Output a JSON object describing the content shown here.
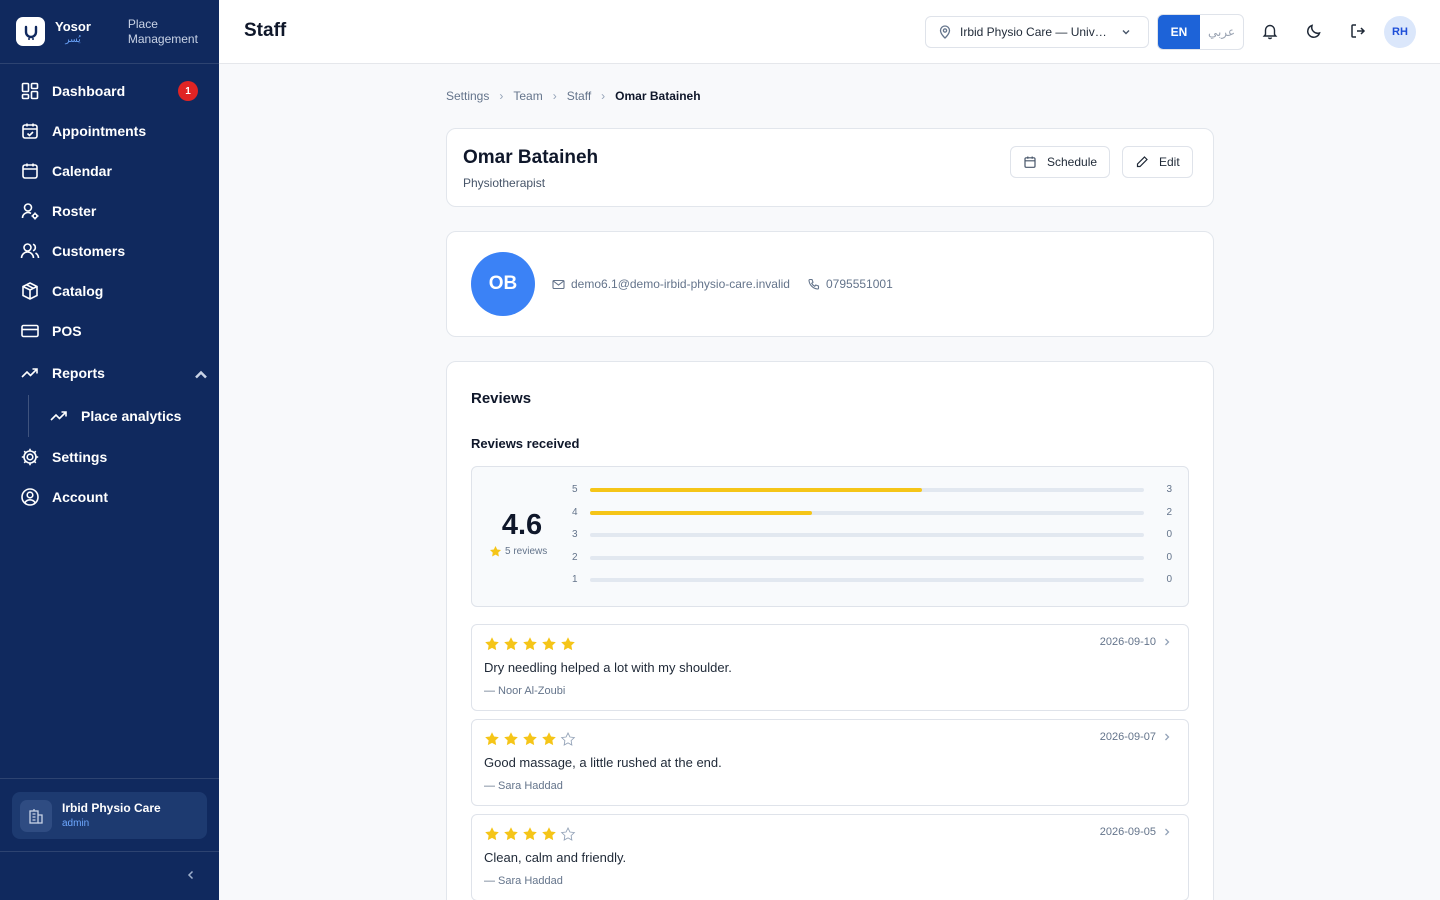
{
  "brand": {
    "name": "Yosor",
    "name_ar": "يُسر",
    "subtitle_line1": "Place",
    "subtitle_line2": "Management"
  },
  "nav": {
    "items": [
      {
        "label": "Dashboard",
        "icon": "dashboard-icon",
        "badge": "1"
      },
      {
        "label": "Appointments",
        "icon": "calendar-check-icon"
      },
      {
        "label": "Calendar",
        "icon": "calendar-icon"
      },
      {
        "label": "Roster",
        "icon": "user-cog-icon"
      },
      {
        "label": "Customers",
        "icon": "users-icon"
      },
      {
        "label": "Catalog",
        "icon": "package-icon"
      },
      {
        "label": "POS",
        "icon": "credit-card-icon"
      },
      {
        "label": "Reports",
        "icon": "trending-up-icon",
        "expanded": true
      },
      {
        "label": "Place analytics",
        "icon": "trending-up-icon"
      },
      {
        "label": "Settings",
        "icon": "gear-icon"
      },
      {
        "label": "Account",
        "icon": "user-circle-icon"
      }
    ]
  },
  "sidebar_footer": {
    "place_name": "Irbid Physio Care",
    "role": "admin"
  },
  "header": {
    "title": "Staff",
    "place_select": "Irbid Physio Care — University Street",
    "lang_en": "EN",
    "lang_ar": "عربي",
    "user_initials": "RH"
  },
  "breadcrumb": [
    "Settings",
    "Team",
    "Staff",
    "Omar Bataineh"
  ],
  "staff": {
    "name": "Omar Bataineh",
    "role": "Physiotherapist",
    "initials": "OB",
    "email": "demo6.1@demo-irbid-physio-care.invalid",
    "phone": "0795551001",
    "schedule_label": "Schedule",
    "edit_label": "Edit"
  },
  "reviews": {
    "title": "Reviews",
    "subtitle": "Reviews received",
    "average": "4.6",
    "count_text": "5 reviews",
    "distribution": [
      {
        "stars": "5",
        "count": "3",
        "fraction": 0.6
      },
      {
        "stars": "4",
        "count": "2",
        "fraction": 0.4
      },
      {
        "stars": "3",
        "count": "0",
        "fraction": 0
      },
      {
        "stars": "2",
        "count": "0",
        "fraction": 0
      },
      {
        "stars": "1",
        "count": "0",
        "fraction": 0
      }
    ],
    "items": [
      {
        "rating": 5,
        "date": "2026-09-10",
        "comment": "Dry needling helped a lot with my shoulder.",
        "author": "— Noor Al-Zoubi"
      },
      {
        "rating": 4,
        "date": "2026-09-07",
        "comment": "Good massage, a little rushed at the end.",
        "author": "— Sara Haddad"
      },
      {
        "rating": 4,
        "date": "2026-09-05",
        "comment": "Clean, calm and friendly.",
        "author": "— Sara Haddad"
      }
    ]
  },
  "colors": {
    "sidebar": "#10295e",
    "accent": "#1d63d8",
    "star": "#f5c518",
    "badge": "#e02424"
  }
}
